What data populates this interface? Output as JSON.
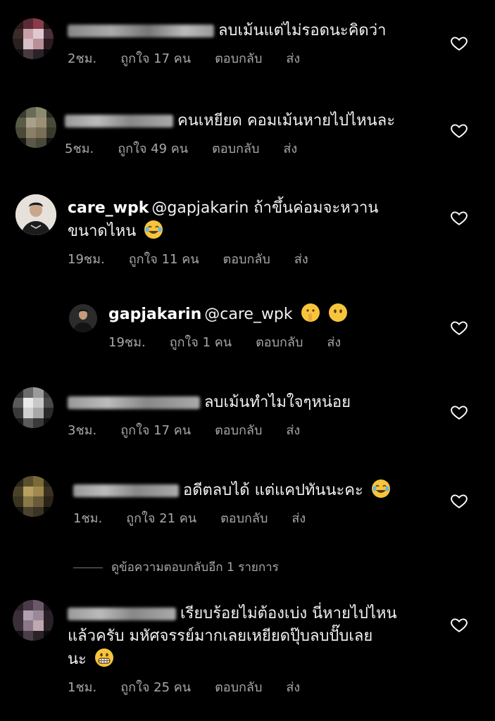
{
  "comments": [
    {
      "username": "",
      "text": "ลบเม้นแต่ไม่รอดนะคิดว่า",
      "time": "2ชม.",
      "likes": "ถูกใจ 17 คน",
      "reply": "ตอบกลับ",
      "send": "ส่ง",
      "username_obscured": true
    },
    {
      "username": "",
      "text": "คนเหยียด คอมเม้นหายไปไหนละ",
      "time": "5ชม.",
      "likes": "ถูกใจ 49 คน",
      "reply": "ตอบกลับ",
      "send": "ส่ง",
      "username_obscured": true
    },
    {
      "username": "care_wpk",
      "text_line1": "@gapjakarin ถ้าขึ้นค่อมจะหวาน",
      "text_line2": "ขนาดไหน",
      "emoji": "joy",
      "time": "19ชม.",
      "likes": "ถูกใจ 11 คน",
      "reply": "ตอบกลับ",
      "send": "ส่ง"
    },
    {
      "username": "gapjakarin",
      "text": "@care_wpk",
      "emojis": [
        "shushing-face",
        "no-mouth-face"
      ],
      "time": "19ชม.",
      "likes": "ถูกใจ 1 คน",
      "reply": "ตอบกลับ",
      "send": "ส่ง",
      "is_reply": true
    },
    {
      "username": "",
      "text": "ลบเม้นทำไมใจๆหน่อย",
      "time": "3ชม.",
      "likes": "ถูกใจ 17 คน",
      "reply": "ตอบกลับ",
      "send": "ส่ง",
      "username_obscured": true
    },
    {
      "username": "",
      "text": "อดีตลบได้ แต่แคปทันนะคะ",
      "emoji": "joy",
      "time": "1ชม.",
      "likes": "ถูกใจ 21 คน",
      "reply": "ตอบกลับ",
      "send": "ส่ง",
      "username_obscured": true
    },
    {
      "username": "",
      "text_line1": "เรียบร้อยไม่ต้องเบ่ง นี่หายไปไหน",
      "text_line2": "แล้วครับ มหัศจรรย์มากเลยเหยียดปุ๊บลบปั๊บเลย",
      "text_line3": "นะ",
      "emoji": "grimacing",
      "time": "1ชม.",
      "likes": "ถูกใจ 25 คน",
      "reply": "ตอบกลับ",
      "send": "ส่ง",
      "username_obscured": true
    }
  ],
  "view_more_replies": "ดูข้อความตอบกลับอีก 1 รายการ",
  "icons": {
    "like": "heart-outline-icon"
  },
  "colors": {
    "background": "#000000",
    "text": "#f2f2f2",
    "meta": "#a8a8a8",
    "emoji": "#f7c53c"
  }
}
